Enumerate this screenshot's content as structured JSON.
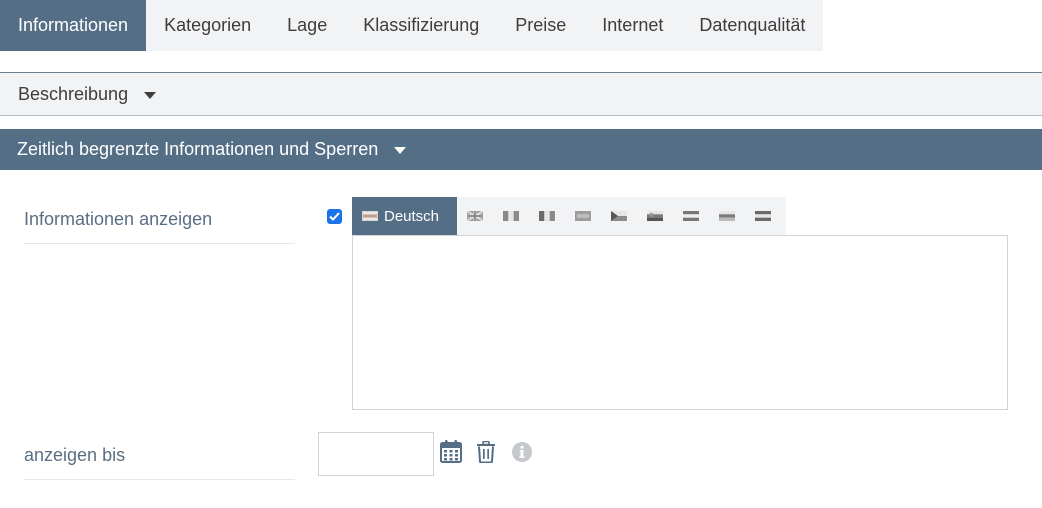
{
  "tabs": [
    {
      "label": "Informationen",
      "active": true
    },
    {
      "label": "Kategorien"
    },
    {
      "label": "Lage"
    },
    {
      "label": "Klassifizierung"
    },
    {
      "label": "Preise"
    },
    {
      "label": "Internet"
    },
    {
      "label": "Datenqualität"
    }
  ],
  "sections": {
    "beschreibung": {
      "title": "Beschreibung",
      "icon": "caret-down-icon"
    },
    "zeitlich": {
      "title": "Zeitlich begrenzte Informationen und Sperren",
      "icon": "caret-down-icon"
    }
  },
  "form": {
    "info_label": "Informationen anzeigen",
    "info_checked": true,
    "language_active": "Deutsch",
    "language_flags": [
      "english-flag-icon",
      "italian-flag-icon",
      "french-flag-icon",
      "flag-icon",
      "czech-flag-icon",
      "slovenian-flag-icon",
      "flag-icon",
      "flag-icon",
      "flag-icon"
    ],
    "info_text": "",
    "bis_label": "anzeigen bis",
    "bis_value": ""
  },
  "colors": {
    "accent": "#546e85",
    "tab_bg": "#f2f3f5",
    "label_text": "#5b6f83",
    "checkbox": "#1a73e8"
  }
}
